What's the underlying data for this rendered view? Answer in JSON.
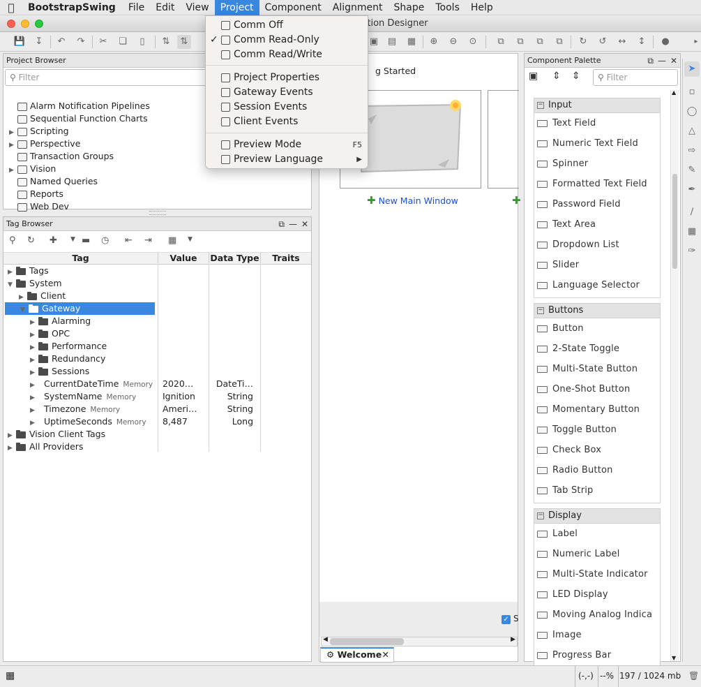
{
  "menubar": {
    "app": "BootstrapSwing",
    "items": [
      "File",
      "Edit",
      "View",
      "Project",
      "Component",
      "Alignment",
      "Shape",
      "Tools",
      "Help"
    ],
    "active": "Project"
  },
  "window": {
    "title": "tion Designer"
  },
  "project_menu": {
    "items": [
      {
        "label": "Comm Off",
        "checked": false,
        "icon": "comm-off-icon"
      },
      {
        "label": "Comm Read-Only",
        "checked": true,
        "icon": "comm-read-only-icon"
      },
      {
        "label": "Comm Read/Write",
        "checked": false,
        "icon": "comm-read-write-icon"
      },
      {
        "label": "Project Properties",
        "icon": "project-properties-icon"
      },
      {
        "label": "Gateway Events",
        "icon": "gateway-events-icon"
      },
      {
        "label": "Session Events",
        "icon": "session-events-icon"
      },
      {
        "label": "Client Events",
        "icon": "client-events-icon"
      },
      {
        "label": "Preview Mode",
        "shortcut": "F5",
        "icon": "preview-mode-icon"
      },
      {
        "label": "Preview Language",
        "submenu": true,
        "icon": "preview-language-icon"
      }
    ]
  },
  "project_browser": {
    "title": "Project Browser",
    "filter_placeholder": "Filter",
    "items": [
      {
        "label": "Alarm Notification Pipelines",
        "expandable": false,
        "icon": "alarm-pipeline-icon"
      },
      {
        "label": "Sequential Function Charts",
        "expandable": false,
        "icon": "sfc-icon"
      },
      {
        "label": "Scripting",
        "expandable": true,
        "icon": "scripting-icon"
      },
      {
        "label": "Perspective",
        "expandable": true,
        "icon": "perspective-icon"
      },
      {
        "label": "Transaction Groups",
        "expandable": false,
        "icon": "transaction-groups-icon"
      },
      {
        "label": "Vision",
        "expandable": true,
        "icon": "vision-icon"
      },
      {
        "label": "Named Queries",
        "expandable": false,
        "icon": "named-queries-icon"
      },
      {
        "label": "Reports",
        "expandable": false,
        "icon": "reports-icon"
      },
      {
        "label": "Web Dev",
        "expandable": false,
        "icon": "web-dev-icon"
      }
    ]
  },
  "tag_browser": {
    "title": "Tag Browser",
    "columns": [
      "Tag",
      "Value",
      "Data Type",
      "Traits"
    ],
    "rows": [
      {
        "name": "Tags",
        "depth": 0,
        "open": false,
        "folder": true
      },
      {
        "name": "System",
        "depth": 0,
        "open": true,
        "folder": true
      },
      {
        "name": "Client",
        "depth": 1,
        "open": false,
        "folder": true
      },
      {
        "name": "Gateway",
        "depth": 1,
        "open": true,
        "folder": true,
        "selected": true
      },
      {
        "name": "Alarming",
        "depth": 2,
        "open": false,
        "folder": true
      },
      {
        "name": "OPC",
        "depth": 2,
        "open": false,
        "folder": true
      },
      {
        "name": "Performance",
        "depth": 2,
        "open": false,
        "folder": true
      },
      {
        "name": "Redundancy",
        "depth": 2,
        "open": false,
        "folder": true
      },
      {
        "name": "Sessions",
        "depth": 2,
        "open": false,
        "folder": true
      },
      {
        "name": "CurrentDateTime",
        "depth": 2,
        "folder": false,
        "trait": "Memory",
        "value": "2020…",
        "type": "DateTi…"
      },
      {
        "name": "SystemName",
        "depth": 2,
        "folder": false,
        "trait": "Memory",
        "value": "Ignition",
        "type": "String"
      },
      {
        "name": "Timezone",
        "depth": 2,
        "folder": false,
        "trait": "Memory",
        "value": "Ameri…",
        "type": "String"
      },
      {
        "name": "UptimeSeconds",
        "depth": 2,
        "folder": false,
        "trait": "Memory",
        "value": "8,487",
        "type": "Long"
      },
      {
        "name": "Vision Client Tags",
        "depth": 0,
        "open": false,
        "folder": true
      },
      {
        "name": "All Providers",
        "depth": 0,
        "open": false,
        "folder": true
      }
    ]
  },
  "workspace": {
    "heading": "g Started",
    "new_main_window": "New Main Window",
    "checkbox_label": "S",
    "tab_label": "Welcome"
  },
  "palette": {
    "title": "Component Palette",
    "filter_placeholder": "Filter",
    "categories": [
      {
        "name": "Input",
        "items": [
          "Text Field",
          "Numeric Text Field",
          "Spinner",
          "Formatted Text Field",
          "Password Field",
          "Text Area",
          "Dropdown List",
          "Slider",
          "Language Selector"
        ]
      },
      {
        "name": "Buttons",
        "items": [
          "Button",
          "2-State Toggle",
          "Multi-State Button",
          "One-Shot Button",
          "Momentary Button",
          "Toggle Button",
          "Check Box",
          "Radio Button",
          "Tab Strip"
        ]
      },
      {
        "name": "Display",
        "items": [
          "Label",
          "Numeric Label",
          "Multi-State Indicator",
          "LED Display",
          "Moving Analog Indica",
          "Image",
          "Progress Bar"
        ]
      }
    ]
  },
  "status": {
    "coords": "(-,-)",
    "zoom": "--%",
    "memory": "197 / 1024 mb"
  },
  "colors": {
    "accent": "#3a87e0",
    "link": "#1a4fd6",
    "add_green": "#2ca02c"
  }
}
